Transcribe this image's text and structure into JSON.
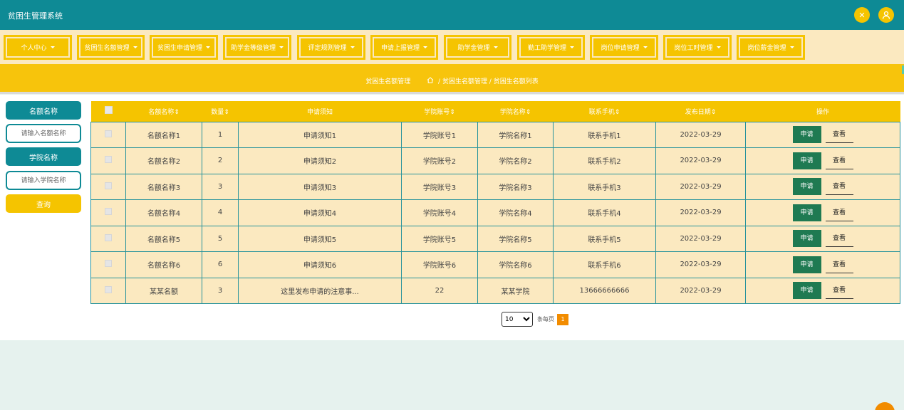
{
  "header": {
    "title": "贫困生管理系统",
    "icons": [
      "fullscreen-icon",
      "user-icon"
    ]
  },
  "nav": {
    "items": [
      {
        "label": "个人中心"
      },
      {
        "label": "贫困生名额管理"
      },
      {
        "label": "贫困生申请管理"
      },
      {
        "label": "助学金等级管理"
      },
      {
        "label": "评定规则管理"
      },
      {
        "label": "申请上报管理"
      },
      {
        "label": "助学金管理"
      },
      {
        "label": "勤工助学管理"
      },
      {
        "label": "岗位申请管理"
      },
      {
        "label": "岗位工时管理"
      },
      {
        "label": "岗位薪金管理"
      }
    ]
  },
  "breadcrumb": {
    "page_title": "贫困生名额管理",
    "path": "/ 贫困生名额管理 / 贫困生名额列表"
  },
  "search": {
    "field1_label": "名额名称",
    "field1_placeholder": "请输入名额名称",
    "field2_label": "学院名称",
    "field2_placeholder": "请输入学院名称",
    "button_label": "查询"
  },
  "table": {
    "headers": [
      "名额名称⇕",
      "数量⇕",
      "申请须知",
      "学院账号⇕",
      "学院名称⇕",
      "联系手机⇕",
      "发布日期⇕",
      "操作"
    ],
    "rows": [
      {
        "name": "名额名称1",
        "qty": "1",
        "notice": "申请须知1",
        "account": "学院账号1",
        "college": "学院名称1",
        "phone": "联系手机1",
        "date": "2022-03-29"
      },
      {
        "name": "名额名称2",
        "qty": "2",
        "notice": "申请须知2",
        "account": "学院账号2",
        "college": "学院名称2",
        "phone": "联系手机2",
        "date": "2022-03-29"
      },
      {
        "name": "名额名称3",
        "qty": "3",
        "notice": "申请须知3",
        "account": "学院账号3",
        "college": "学院名称3",
        "phone": "联系手机3",
        "date": "2022-03-29"
      },
      {
        "name": "名额名称4",
        "qty": "4",
        "notice": "申请须知4",
        "account": "学院账号4",
        "college": "学院名称4",
        "phone": "联系手机4",
        "date": "2022-03-29"
      },
      {
        "name": "名额名称5",
        "qty": "5",
        "notice": "申请须知5",
        "account": "学院账号5",
        "college": "学院名称5",
        "phone": "联系手机5",
        "date": "2022-03-29"
      },
      {
        "name": "名额名称6",
        "qty": "6",
        "notice": "申请须知6",
        "account": "学院账号6",
        "college": "学院名称6",
        "phone": "联系手机6",
        "date": "2022-03-29"
      },
      {
        "name": "某某名额",
        "qty": "3",
        "notice": "这里发布申请的注意事...",
        "account": "22",
        "college": "某某学院",
        "phone": "13666666666",
        "date": "2022-03-29"
      }
    ],
    "apply_label": "申请",
    "view_label": "查看"
  },
  "pagination": {
    "page_size": "10",
    "per_page_label": "条每页",
    "current_page": "1"
  },
  "colors": {
    "header": "#0e8a95",
    "accent": "#f5c400",
    "nav_bg": "#fbe9c0",
    "apply_button": "#1f7a52",
    "page_active": "#f28c00"
  }
}
